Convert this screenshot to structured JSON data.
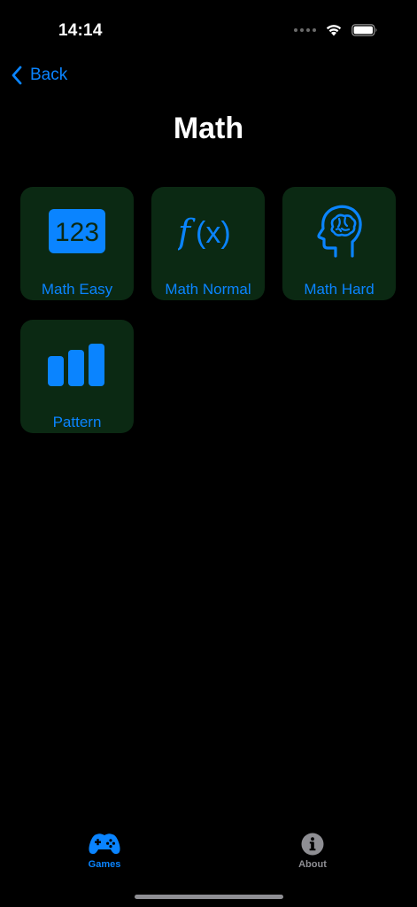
{
  "status_bar": {
    "time": "14:14"
  },
  "nav": {
    "back_label": "Back",
    "title": "Math"
  },
  "games": [
    {
      "label": "Math Easy",
      "icon": "number-123-icon"
    },
    {
      "label": "Math Normal",
      "icon": "function-fx-icon"
    },
    {
      "label": "Math Hard",
      "icon": "brain-head-icon"
    },
    {
      "label": "Pattern",
      "icon": "bar-chart-icon"
    }
  ],
  "tab_bar": {
    "games_label": "Games",
    "about_label": "About"
  },
  "colors": {
    "accent": "#0a84ff",
    "tile_background": "#0b2913",
    "background": "#000000",
    "inactive_tab": "#8e8e93"
  }
}
